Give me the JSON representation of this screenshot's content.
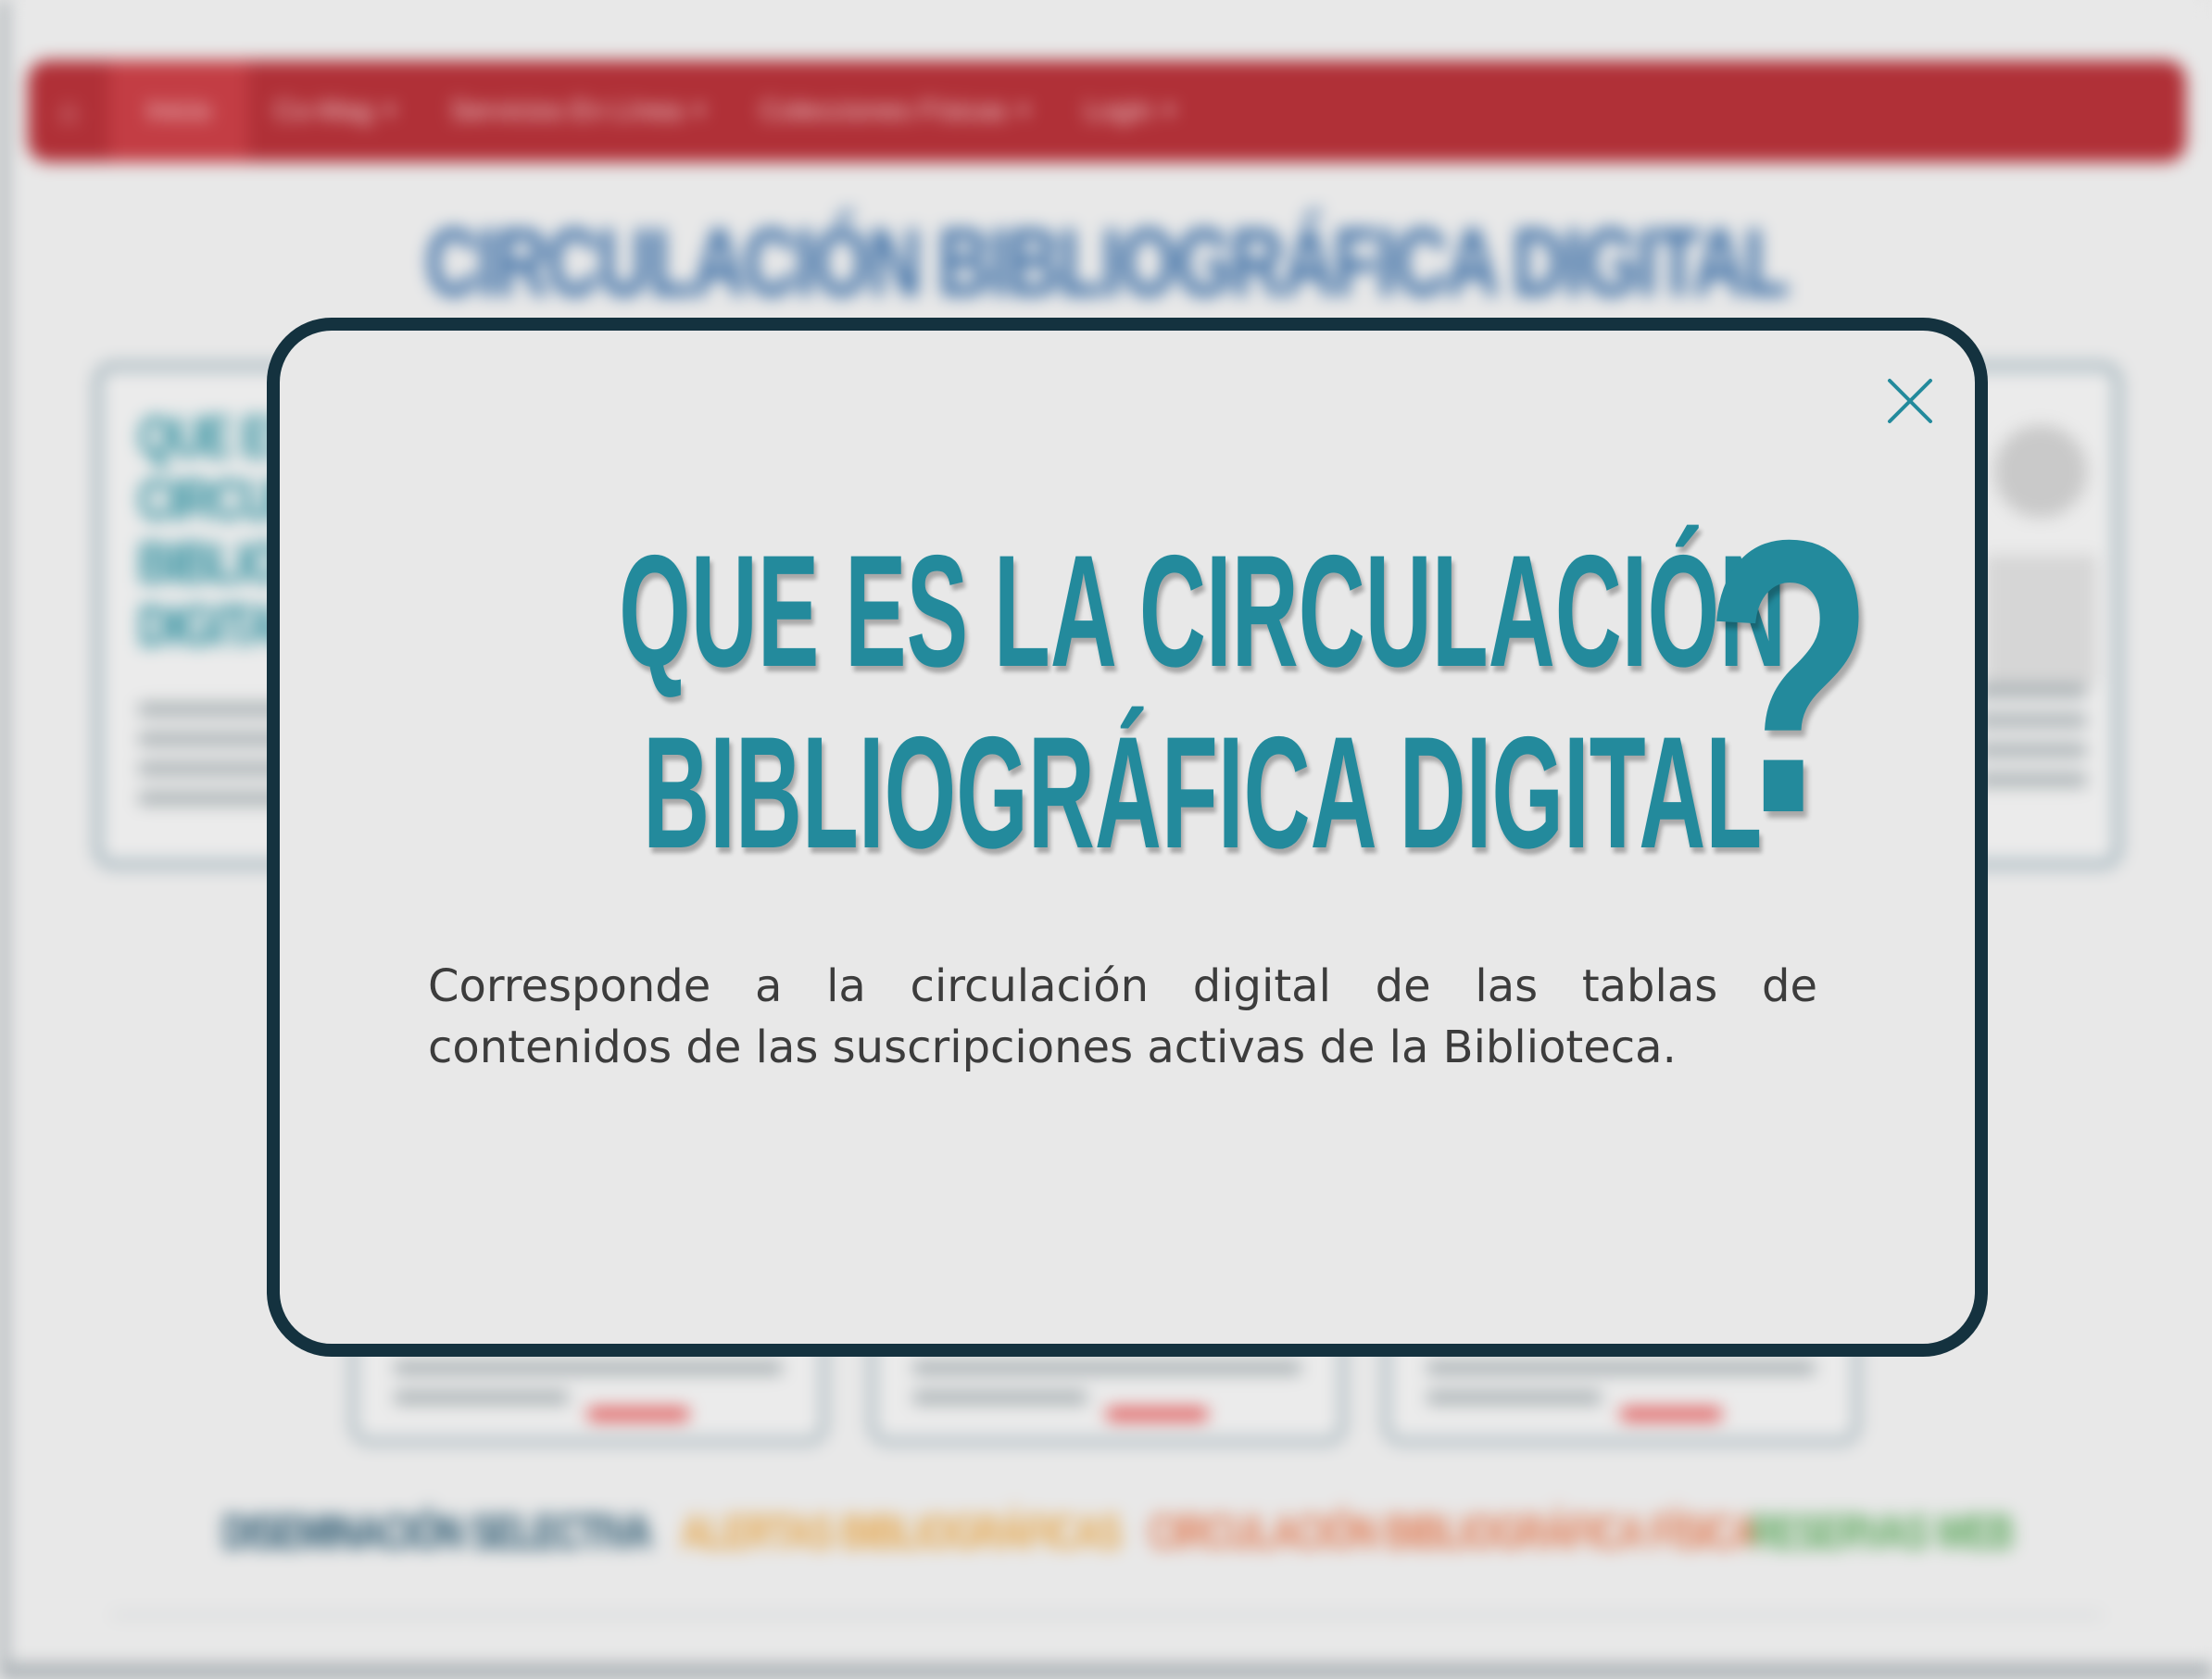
{
  "background": {
    "navbar": {
      "items": [
        {
          "label": "Inicio",
          "active": true,
          "dropdown": false
        },
        {
          "label": "Co-Mag",
          "dropdown": true
        },
        {
          "label": "Servicios En Línea",
          "dropdown": true
        },
        {
          "label": "Colecciones Físicas",
          "dropdown": true
        },
        {
          "label": "Login",
          "dropdown": true
        }
      ],
      "home_icon": "home-icon",
      "color": "#b03037"
    },
    "page_title": "CIRCULACIÓN BIBLIOGRÁFICA DIGITAL",
    "card_heading": "QUE ES LA CIRCULACIÓN BIBLIOGRÁFICA DIGITAL",
    "links": [
      {
        "label": "DISEMINACIÓN SELECTIVA",
        "color": "#24536c"
      },
      {
        "label": "ALERTAS BIBLIOGRÁFICAS",
        "color": "#e6a548"
      },
      {
        "label": "CIRCULACIÓN BIBLIOGRÁFICA FÍSICA",
        "color": "#e07a52"
      },
      {
        "label": "RESERVAS WEB",
        "color": "#5aa75a"
      }
    ]
  },
  "modal": {
    "heading_line1": "QUE ES LA CIRCULACIÓN",
    "heading_line2": "BIBLIOGRÁFICA DIGITAL",
    "question_mark": "?",
    "body": "Corresponde a la circulación digital de las tablas de contenidos de las suscripciones activas de la Biblioteca.",
    "close_icon": "close-icon",
    "accent_color": "#238a9c",
    "border_color": "#14323f"
  }
}
